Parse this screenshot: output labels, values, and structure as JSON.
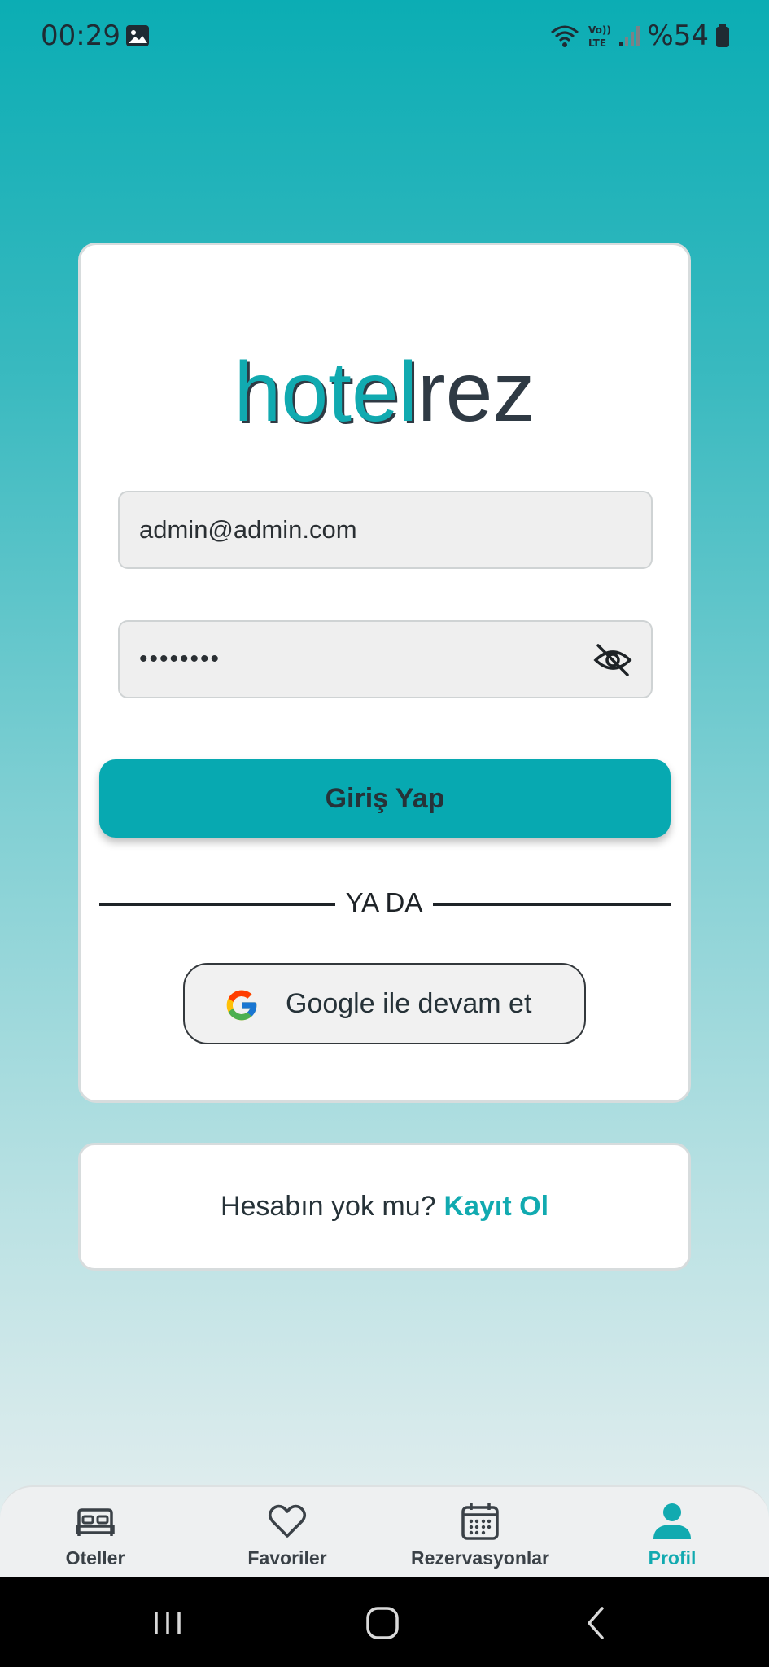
{
  "status_bar": {
    "time": "00:29",
    "battery": "%54",
    "icons": [
      "image-icon",
      "wifi-icon",
      "volte-icon",
      "signal-icon",
      "battery-icon"
    ]
  },
  "login": {
    "logo_part1": "hotel",
    "logo_part2": "rez",
    "email_value": "admin@admin.com",
    "password_value": "••••••••",
    "login_button": "Giriş Yap",
    "divider_text": "YA DA",
    "google_button": "Google ile devam et"
  },
  "register": {
    "prompt": "Hesabın yok mu?",
    "link": "Kayıt Ol"
  },
  "bottom_nav": {
    "items": [
      {
        "label": "Oteller",
        "icon": "bed-icon"
      },
      {
        "label": "Favoriler",
        "icon": "heart-icon"
      },
      {
        "label": "Rezervasyonlar",
        "icon": "calendar-icon"
      },
      {
        "label": "Profil",
        "icon": "user-icon",
        "active": true
      }
    ]
  },
  "colors": {
    "accent": "#11aab0",
    "dark": "#2f3a44"
  }
}
